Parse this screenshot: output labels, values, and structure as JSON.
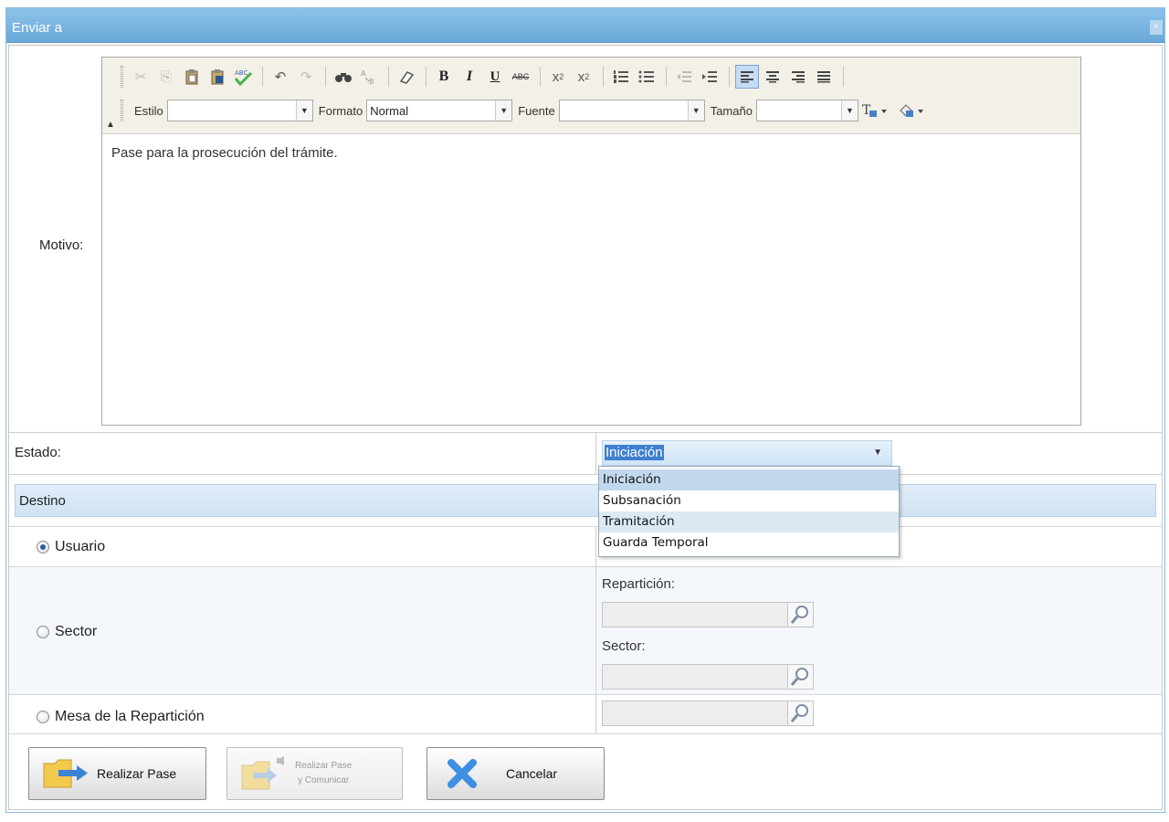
{
  "window": {
    "title": "Enviar a",
    "close_glyph": "×"
  },
  "motivo": {
    "label": "Motivo:",
    "body_text": "Pase para la prosecución del trámite."
  },
  "toolbar": {
    "row1_icons": [
      "cut-icon",
      "copy-icon",
      "paste-icon",
      "paste-word-icon",
      "spellcheck-icon",
      "undo-icon",
      "redo-icon",
      "find-icon",
      "replace-icon",
      "eraser-icon",
      "bold-icon",
      "italic-icon",
      "underline-icon",
      "strikethrough-icon",
      "subscript-icon",
      "superscript-icon",
      "ordered-list-icon",
      "unordered-list-icon",
      "outdent-icon",
      "indent-icon",
      "align-left-icon",
      "align-center-icon",
      "align-right-icon",
      "justify-icon"
    ],
    "bold_glyph": "B",
    "italic_glyph": "I",
    "underline_glyph": "U",
    "strike_glyph": "ABC",
    "sub_glyph": "x",
    "sup_glyph": "x",
    "sub_mark": "2",
    "sup_mark": "2",
    "estilo_label": "Estilo",
    "estilo_value": "",
    "formato_label": "Formato",
    "formato_value": "Normal",
    "fuente_label": "Fuente",
    "fuente_value": "",
    "tamano_label": "Tamaño",
    "tamano_value": ""
  },
  "estado": {
    "label": "Estado:",
    "selected": "Iniciación",
    "options": [
      "Iniciación",
      "Subsanación",
      "Tramitación",
      "Guarda Temporal"
    ]
  },
  "destino": {
    "header": "Destino",
    "usuario_label": "Usuario",
    "sector_label": "Sector",
    "mesa_label": "Mesa de la Repartición",
    "reparticion_label": "Repartición:",
    "sector_field_label": "Sector:"
  },
  "buttons": {
    "realizar_pase": "Realizar Pase",
    "realizar_pase_comunicar_l1": "Realizar Pase",
    "realizar_pase_comunicar_l2": "y Comunicar",
    "cancelar": "Cancelar"
  },
  "colors": {
    "title_bar": "#6aa9d8",
    "selection": "#3e7fd0",
    "cancel_x": "#3d8fe0"
  }
}
